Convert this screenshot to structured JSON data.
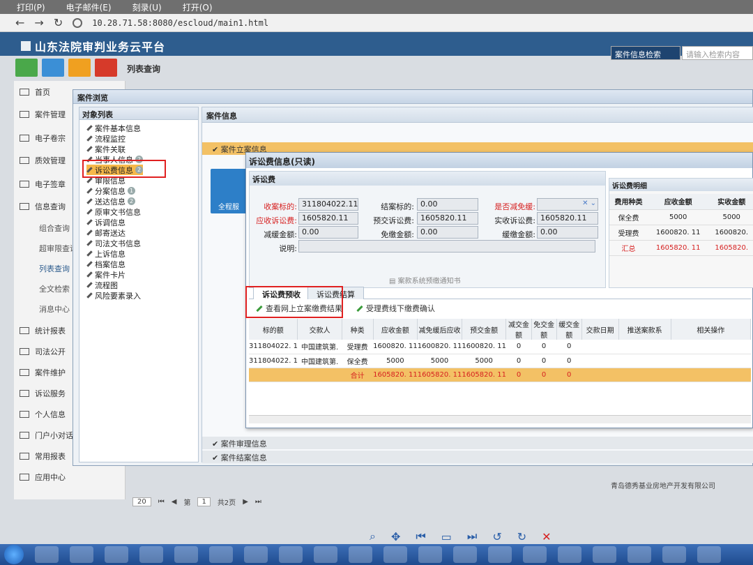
{
  "browser": {
    "menus": [
      "打印(P)",
      "电子邮件(E)",
      "刻录(U)",
      "打开(O)"
    ],
    "url": "10.28.71.58:8080/escloud/main1.html"
  },
  "app": {
    "title": "山东法院审判业务云平台",
    "search_combo": "案件信息检索",
    "search_placeholder": "请输入检索内容"
  },
  "toolbar": {
    "list_query": "列表查询"
  },
  "leftnav": {
    "items": [
      "首页",
      "案件管理",
      "电子卷宗",
      "质效管理",
      "电子签章",
      "信息查询",
      "统计报表",
      "司法公开",
      "案件维护",
      "诉讼服务",
      "个人信息",
      "门户小对话",
      "常用报表",
      "应用中心"
    ],
    "subs": [
      "组合查询",
      "超审限查询",
      "列表查询",
      "全文检索",
      "消息中心"
    ]
  },
  "dialog": {
    "title": "案件浏览",
    "object_list": "对象列表",
    "tree": [
      {
        "label": "案件基本信息"
      },
      {
        "label": "流程监控"
      },
      {
        "label": "案件关联"
      },
      {
        "label": "当事人信息",
        "badge": "2"
      },
      {
        "label": "诉讼费信息",
        "badge": "2"
      },
      {
        "label": "审限信息"
      },
      {
        "label": "分案信息",
        "badge": "1"
      },
      {
        "label": "送达信息",
        "badge": "2"
      },
      {
        "label": "原审文书信息"
      },
      {
        "label": "诉调信息"
      },
      {
        "label": "邮寄送达"
      },
      {
        "label": "司法文书信息"
      },
      {
        "label": "上诉信息"
      },
      {
        "label": "档案信息"
      },
      {
        "label": "案件卡片"
      },
      {
        "label": "流程图"
      },
      {
        "label": "风险要素录入"
      }
    ],
    "case_info": "案件信息",
    "case_filing": "案件立案信息",
    "full_button": "全程服",
    "case_trial": "案件审理信息",
    "case_archive": "案件结案信息"
  },
  "fee": {
    "title": "诉讼费信息(只读)",
    "panel": "诉讼费",
    "labels": {
      "subject": "收案标的:",
      "receivable": "应收诉讼费:",
      "reduce": "减缓金额:",
      "desc": "说明:",
      "close_subject": "结案标的:",
      "prepaid": "预交诉讼费:",
      "exempt": "免缴金额:",
      "is_reduce": "是否减免缓:",
      "actual": "实收诉讼费:",
      "defer": "缓缴金额:"
    },
    "values": {
      "subject": "311804022.11",
      "receivable": "1605820.11",
      "reduce": "0.00",
      "close_subject": "0.00",
      "prepaid": "1605820.11",
      "exempt": "0.00",
      "actual": "1605820.11",
      "defer": "0.00"
    },
    "notice": "案款系统预缴通知书"
  },
  "fee_detail": {
    "title": "诉讼费明细",
    "headers": [
      "费用种类",
      "应收金额",
      "实收金额"
    ],
    "rows": [
      [
        "保全费",
        "5000",
        "5000"
      ],
      [
        "受理费",
        "1600820. 11",
        "1600820."
      ],
      [
        "汇总",
        "1605820. 11",
        "1605820."
      ]
    ]
  },
  "tabs": [
    "诉讼费预收",
    "诉讼费结算"
  ],
  "actions": [
    "查看网上立案缴费结果",
    "受理费线下缴费确认"
  ],
  "grid": {
    "headers": [
      "标的额",
      "交款人",
      "种类",
      "应收金额",
      "减免缓后应收",
      "预交金额",
      "减交金额",
      "免交金额",
      "缓交金额",
      "交款日期",
      "推送案款系",
      "相关操作"
    ],
    "rows": [
      [
        "311804022. 1",
        "中国建筑第.",
        "受理费",
        "1600820. 11",
        "1600820. 11",
        "1600820. 11",
        "0",
        "0",
        "0",
        "",
        "",
        ""
      ],
      [
        "311804022. 1",
        "中国建筑第.",
        "保全费",
        "5000",
        "5000",
        "5000",
        "0",
        "0",
        "0",
        "",
        "",
        ""
      ]
    ],
    "total": [
      "",
      "",
      "合计",
      "1605820. 11",
      "1605820. 11",
      "1605820. 11",
      "0",
      "0",
      "0",
      "",
      "",
      ""
    ]
  },
  "footer": {
    "pager_size": "20",
    "page_label": "第",
    "page_num": "1",
    "page_total": "共2页",
    "company": "青岛德秀基业房地产开发有限公司"
  },
  "colors": {
    "header": "#2e5d8e",
    "highlight": "#f3c165",
    "red": "#d62020"
  }
}
